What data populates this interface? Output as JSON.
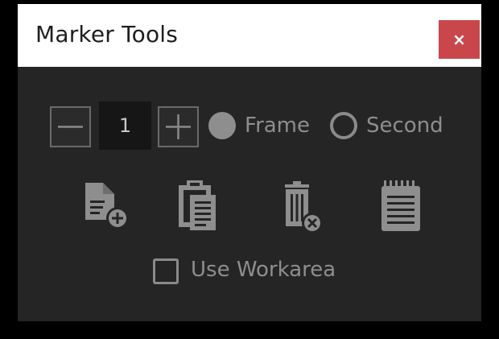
{
  "window": {
    "title": "Marker Tools",
    "close_label": "×"
  },
  "stepper": {
    "value": "1",
    "decrement_icon": "minus-icon",
    "increment_icon": "plus-icon"
  },
  "unit_options": [
    {
      "label": "Frame",
      "selected": true
    },
    {
      "label": "Second",
      "selected": false
    }
  ],
  "tools": [
    {
      "name": "add-marker",
      "icon": "document-add-icon"
    },
    {
      "name": "paste-markers",
      "icon": "clipboard-icon"
    },
    {
      "name": "delete-markers",
      "icon": "trash-remove-icon"
    },
    {
      "name": "marker-list",
      "icon": "notepad-icon"
    }
  ],
  "workarea": {
    "label": "Use Workarea",
    "checked": false
  },
  "colors": {
    "window_bg": "#252525",
    "titlebar_bg": "#ffffff",
    "close_bg": "#c9474b",
    "control_gray": "#8e8e8e",
    "input_bg": "#161616"
  }
}
